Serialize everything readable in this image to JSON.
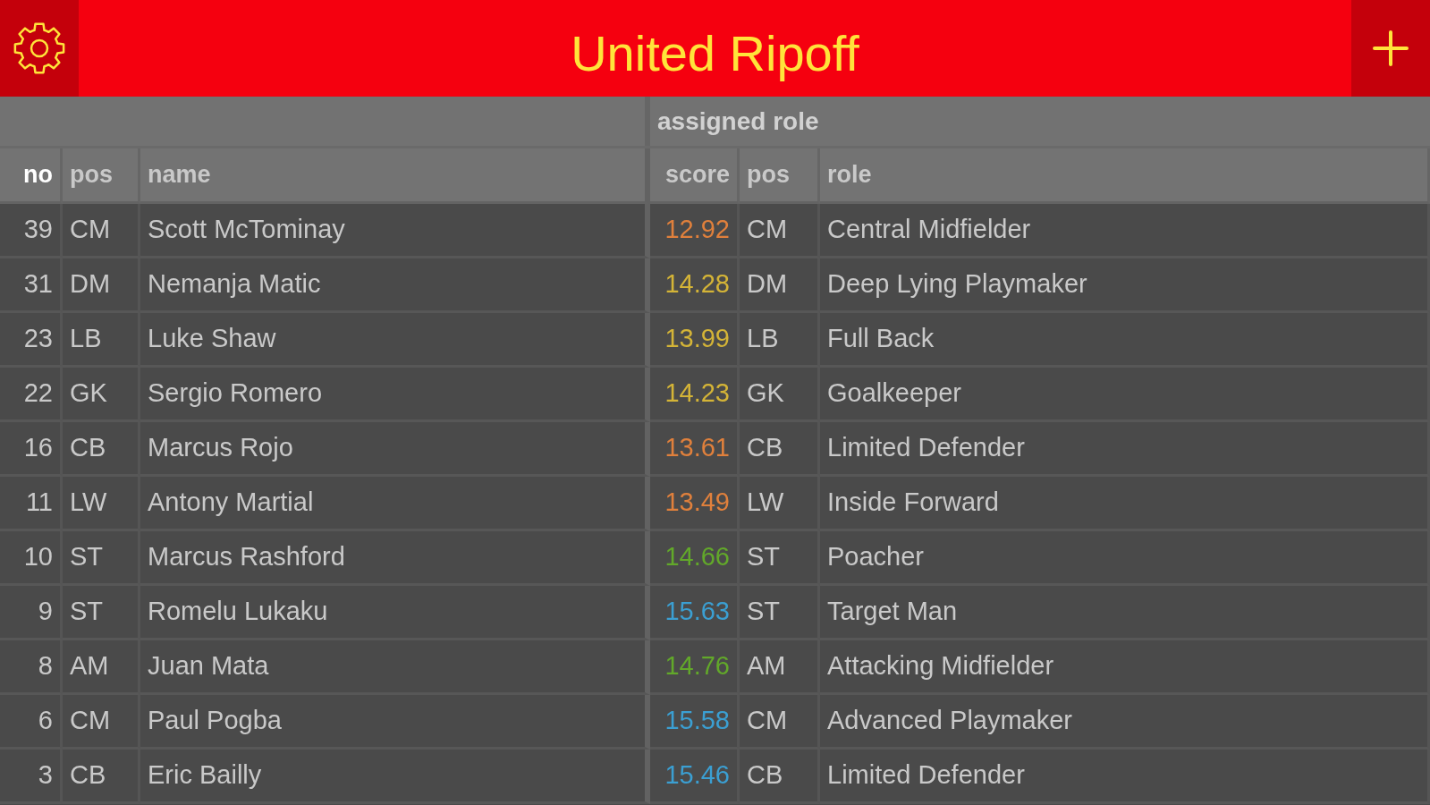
{
  "header": {
    "title": "United Ripoff"
  },
  "table": {
    "group_label": "assigned role",
    "columns": [
      {
        "label": "no",
        "sorted": true
      },
      {
        "label": "pos",
        "sorted": false
      },
      {
        "label": "name",
        "sorted": false
      },
      {
        "label": "score",
        "sorted": false
      },
      {
        "label": "pos",
        "sorted": false
      },
      {
        "label": "role",
        "sorted": false
      }
    ],
    "rows": [
      {
        "no": "39",
        "pos": "CM",
        "name": "Scott McTominay",
        "score": "12.92",
        "color": "#e0803c",
        "role_pos": "CM",
        "role": "Central Midfielder"
      },
      {
        "no": "31",
        "pos": "DM",
        "name": "Nemanja Matic",
        "score": "14.28",
        "color": "#d4b437",
        "role_pos": "DM",
        "role": "Deep Lying Playmaker"
      },
      {
        "no": "23",
        "pos": "LB",
        "name": "Luke Shaw",
        "score": "13.99",
        "color": "#d4b437",
        "role_pos": "LB",
        "role": "Full Back"
      },
      {
        "no": "22",
        "pos": "GK",
        "name": "Sergio Romero",
        "score": "14.23",
        "color": "#d4b437",
        "role_pos": "GK",
        "role": "Goalkeeper"
      },
      {
        "no": "16",
        "pos": "CB",
        "name": "Marcus Rojo",
        "score": "13.61",
        "color": "#e0803c",
        "role_pos": "CB",
        "role": "Limited Defender"
      },
      {
        "no": "11",
        "pos": "LW",
        "name": "Antony Martial",
        "score": "13.49",
        "color": "#e0803c",
        "role_pos": "LW",
        "role": "Inside Forward"
      },
      {
        "no": "10",
        "pos": "ST",
        "name": "Marcus Rashford",
        "score": "14.66",
        "color": "#62a82a",
        "role_pos": "ST",
        "role": "Poacher"
      },
      {
        "no": "9",
        "pos": "ST",
        "name": "Romelu Lukaku",
        "score": "15.63",
        "color": "#3b9fd2",
        "role_pos": "ST",
        "role": "Target Man"
      },
      {
        "no": "8",
        "pos": "AM",
        "name": "Juan Mata",
        "score": "14.76",
        "color": "#62a82a",
        "role_pos": "AM",
        "role": "Attacking Midfielder"
      },
      {
        "no": "6",
        "pos": "CM",
        "name": "Paul Pogba",
        "score": "15.58",
        "color": "#3b9fd2",
        "role_pos": "CM",
        "role": "Advanced Playmaker"
      },
      {
        "no": "3",
        "pos": "CB",
        "name": "Eric Bailly",
        "score": "15.46",
        "color": "#3b9fd2",
        "role_pos": "CB",
        "role": "Limited Defender"
      }
    ]
  }
}
